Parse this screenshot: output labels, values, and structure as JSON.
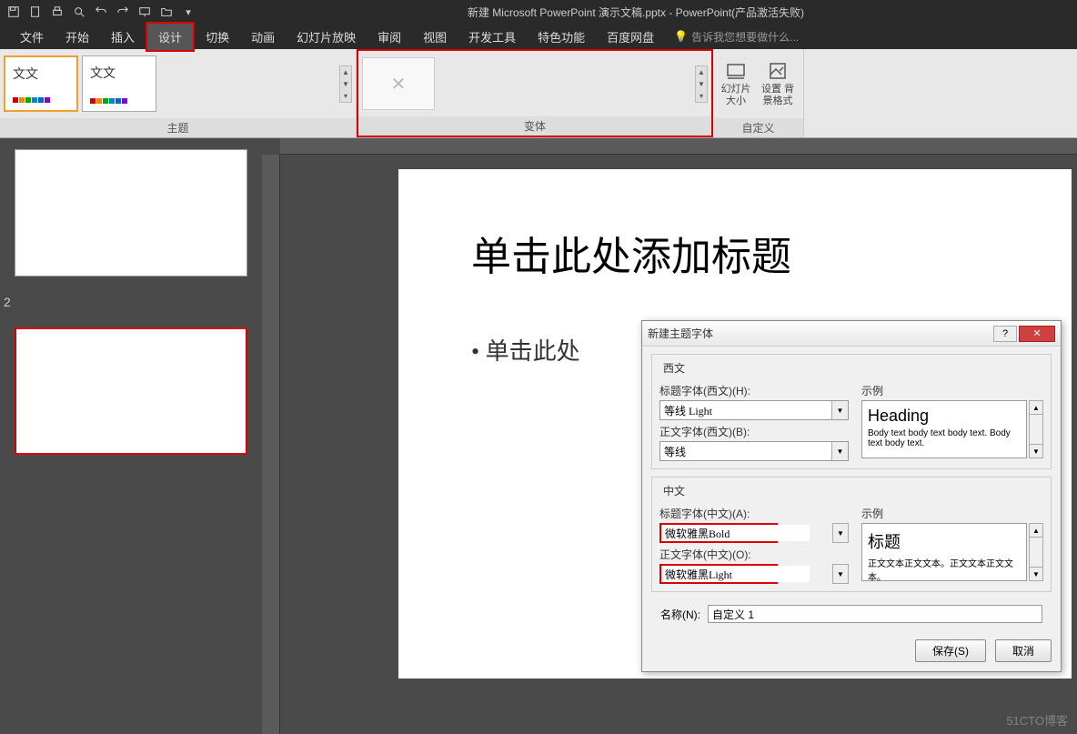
{
  "titlebar": {
    "title": "新建 Microsoft PowerPoint 演示文稿.pptx - PowerPoint(产品激活失败)"
  },
  "menu": {
    "items": [
      "文件",
      "开始",
      "插入",
      "设计",
      "切换",
      "动画",
      "幻灯片放映",
      "审阅",
      "视图",
      "开发工具",
      "特色功能",
      "百度网盘"
    ],
    "active_index": 3,
    "tell_me": "告诉我您想要做什么..."
  },
  "ribbon": {
    "themes": {
      "label": "主题",
      "thumb_text": "文文"
    },
    "variants": {
      "label": "变体"
    },
    "custom": {
      "label": "自定义",
      "slide_size": "幻灯片\n大小",
      "bg_format": "设置\n背景格式"
    }
  },
  "slide": {
    "title_placeholder": "单击此处添加标题",
    "body_placeholder": "• 单击此处"
  },
  "dialog": {
    "title": "新建主题字体",
    "latin": {
      "legend": "西文",
      "heading_label": "标题字体(西文)(H):",
      "heading_value": "等线 Light",
      "body_label": "正文字体(西文)(B):",
      "body_value": "等线",
      "sample_label": "示例",
      "sample_heading": "Heading",
      "sample_body": "Body text body text body text. Body text body text."
    },
    "chinese": {
      "legend": "中文",
      "heading_label": "标题字体(中文)(A):",
      "heading_value": "微软雅黑Bold",
      "body_label": "正文字体(中文)(O):",
      "body_value": "微软雅黑Light",
      "sample_label": "示例",
      "sample_heading": "标题",
      "sample_body": "正文文本正文文本。正文文本正文文本。"
    },
    "name_label": "名称(N):",
    "name_value": "自定义 1",
    "save": "保存(S)",
    "cancel": "取消"
  },
  "watermark": "51CTO博客"
}
